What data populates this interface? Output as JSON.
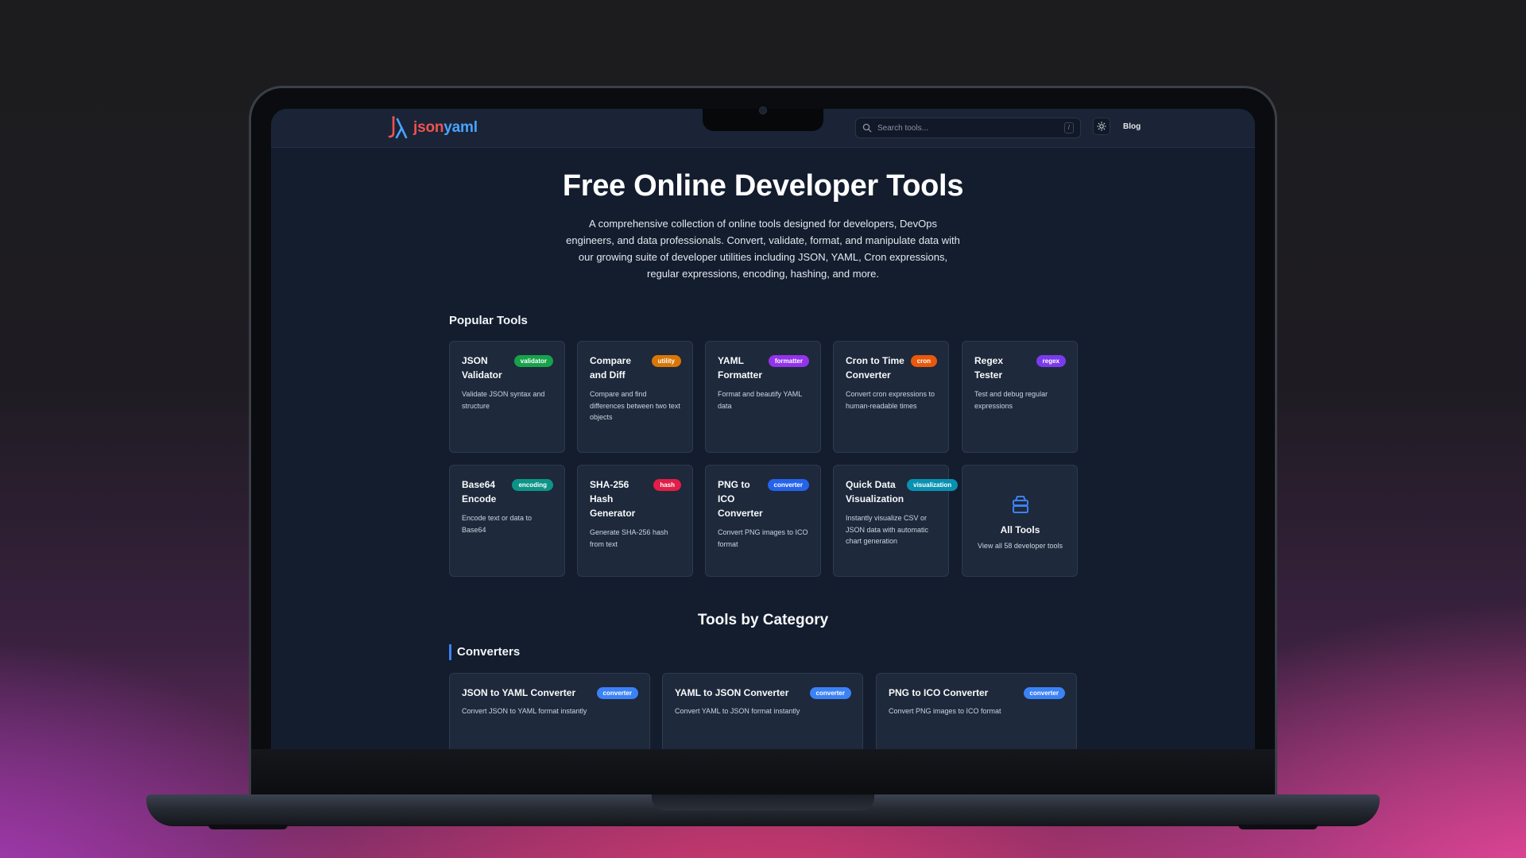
{
  "header": {
    "logo_part1": "json",
    "logo_part2": "yaml",
    "search_placeholder": "Search tools...",
    "search_shortcut": "/",
    "blog_label": "Blog"
  },
  "hero": {
    "title": "Free Online Developer Tools",
    "description": "A comprehensive collection of online tools designed for developers, DevOps engineers, and data professionals. Convert, validate, format, and manipulate data with our growing suite of developer utilities including JSON, YAML, Cron expressions, regular expressions, encoding, hashing, and more."
  },
  "popular": {
    "title": "Popular Tools",
    "tools": [
      {
        "title": "JSON Validator",
        "badge": "validator",
        "badge_color": "#16a34a",
        "desc": "Validate JSON syntax and structure"
      },
      {
        "title": "Compare and Diff",
        "badge": "utility",
        "badge_color": "#d97706",
        "desc": "Compare and find differences between two text objects"
      },
      {
        "title": "YAML Formatter",
        "badge": "formatter",
        "badge_color": "#9333ea",
        "desc": "Format and beautify YAML data"
      },
      {
        "title": "Cron to Time Converter",
        "badge": "cron",
        "badge_color": "#ea580c",
        "desc": "Convert cron expressions to human-readable times"
      },
      {
        "title": "Regex Tester",
        "badge": "regex",
        "badge_color": "#7c3aed",
        "desc": "Test and debug regular expressions"
      },
      {
        "title": "Base64 Encode",
        "badge": "encoding",
        "badge_color": "#0d9488",
        "desc": "Encode text or data to Base64"
      },
      {
        "title": "SHA-256 Hash Generator",
        "badge": "hash",
        "badge_color": "#e11d48",
        "desc": "Generate SHA-256 hash from text"
      },
      {
        "title": "PNG to ICO Converter",
        "badge": "converter",
        "badge_color": "#2563eb",
        "desc": "Convert PNG images to ICO format"
      },
      {
        "title": "Quick Data Visualization",
        "badge": "visualization",
        "badge_color": "#0891b2",
        "desc": "Instantly visualize CSV or JSON data with automatic chart generation"
      }
    ],
    "all_tools": {
      "title": "All Tools",
      "desc": "View all 58 developer tools"
    }
  },
  "categories": {
    "title": "Tools by Category",
    "converters": {
      "title": "Converters",
      "tools": [
        {
          "title": "JSON to YAML Converter",
          "badge": "converter",
          "desc": "Convert JSON to YAML format instantly"
        },
        {
          "title": "YAML to JSON Converter",
          "badge": "converter",
          "desc": "Convert YAML to JSON format instantly"
        },
        {
          "title": "PNG to ICO Converter",
          "badge": "converter",
          "desc": "Convert PNG images to ICO format"
        }
      ]
    }
  },
  "colors": {
    "accent": "#3b82f6",
    "logo_red": "#ef5350",
    "logo_blue": "#4aa3ff",
    "card_bg": "#1e293b",
    "page_bg": "#141d2e"
  }
}
